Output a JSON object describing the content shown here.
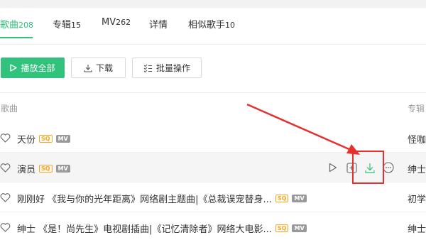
{
  "tabs": [
    {
      "label": "歌曲",
      "count": "208",
      "active": true
    },
    {
      "label": "专辑",
      "count": "15",
      "active": false
    },
    {
      "label": "MV",
      "count": "262",
      "active": false
    },
    {
      "label": "详情",
      "count": "",
      "active": false
    },
    {
      "label": "相似歌手",
      "count": "10",
      "active": false
    }
  ],
  "toolbar": {
    "play_all_label": "播放全部",
    "download_label": "下载",
    "batch_label": "批量操作"
  },
  "columns": {
    "song": "歌曲",
    "album": "专辑"
  },
  "badges": {
    "sq": "SQ",
    "mv": "MV"
  },
  "songs": [
    {
      "title": "天份",
      "album": "怪咖"
    },
    {
      "title": "演员",
      "album": "绅士"
    },
    {
      "title": "刚刚好 《我与你的光年距离》网络剧主题曲|《总裁误宠替身...",
      "album": "初学"
    },
    {
      "title": "绅士 《是！尚先生》电视剧插曲|《记忆清除者》网络大电影...",
      "album": "绅士"
    }
  ],
  "colors": {
    "accent": "#31c27c",
    "annotation": "#e53030",
    "sq_badge": "#f5a623",
    "mv_badge": "#999999"
  },
  "icons": {
    "heart": "heart-icon",
    "play": "play-icon",
    "add": "add-to-list-icon",
    "download": "download-icon",
    "more": "more-icon"
  }
}
